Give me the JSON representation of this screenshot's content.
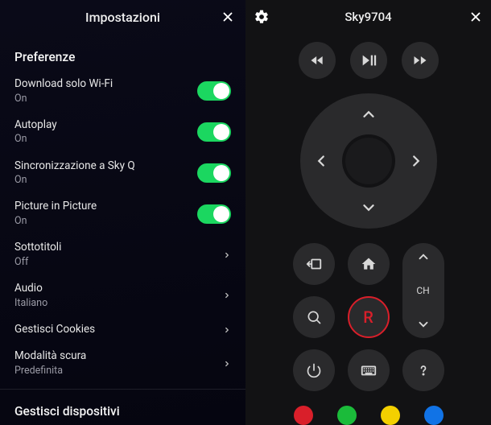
{
  "settings": {
    "title": "Impostazioni",
    "section1_title": "Preferenze",
    "section2_title": "Gestisci dispositivi",
    "items": [
      {
        "label": "Download solo Wi-Fi",
        "sub": "On",
        "type": "toggle",
        "on": true
      },
      {
        "label": "Autoplay",
        "sub": "On",
        "type": "toggle",
        "on": true
      },
      {
        "label": "Sincronizzazione a Sky Q",
        "sub": "On",
        "type": "toggle",
        "on": true
      },
      {
        "label": "Picture in Picture",
        "sub": "On",
        "type": "toggle",
        "on": true
      },
      {
        "label": "Sottotitoli",
        "sub": "Off",
        "type": "chevron"
      },
      {
        "label": "Audio",
        "sub": "Italiano",
        "type": "chevron"
      },
      {
        "label": "Gestisci Cookies",
        "sub": "",
        "type": "chevron"
      },
      {
        "label": "Modalità scura",
        "sub": "Predefinita",
        "type": "chevron"
      }
    ]
  },
  "remote": {
    "device_name": "Sky9704",
    "ch_label": "CH",
    "record_label": "R",
    "color_buttons": [
      "#d91f2a",
      "#1bbb3a",
      "#f3d000",
      "#1173e6"
    ]
  }
}
